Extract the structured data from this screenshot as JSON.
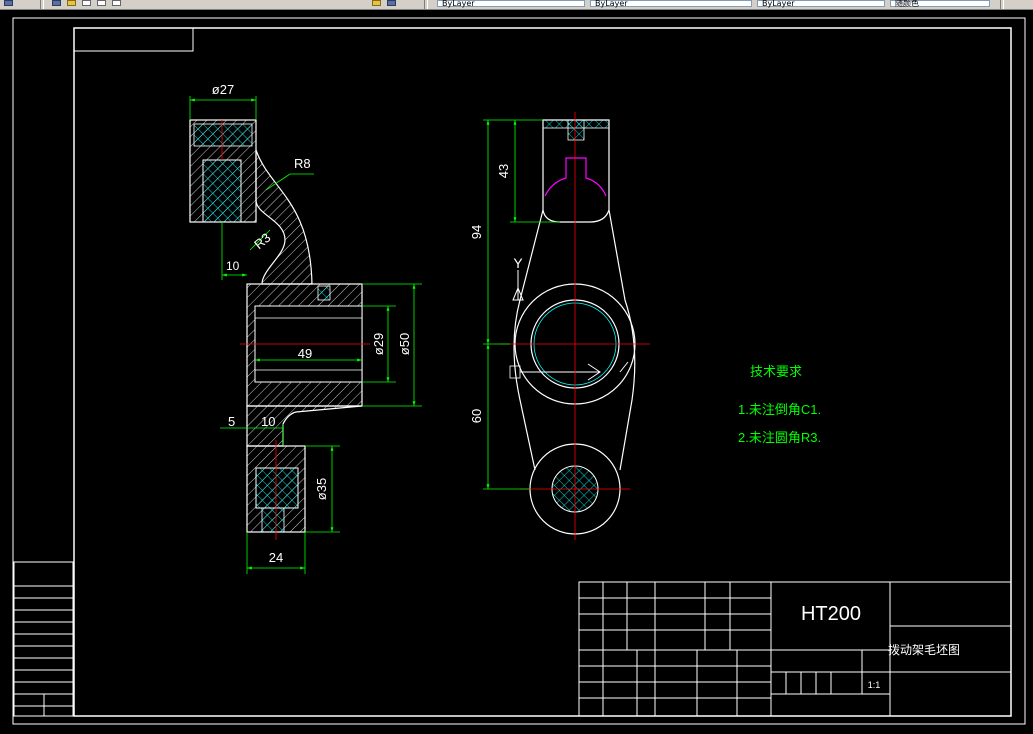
{
  "window": {
    "title": ""
  },
  "toolbar": {
    "layer_fields": [
      "ByLayer",
      "ByLayer",
      "ByLayer"
    ],
    "plot_style": "随颜色"
  },
  "drawing": {
    "technical_requirements": {
      "heading": "技术要求",
      "items": [
        "1.未注倒角C1.",
        "2.未注圆角R3."
      ]
    },
    "title_block": {
      "material": "HT200",
      "part_name": "拨动架毛坯图",
      "scale": "1:1"
    },
    "dimensions": {
      "side": {
        "d27": "ø27",
        "r8": "R8",
        "r3": "R3",
        "d10a": "10",
        "d49": "49",
        "d29": "ø29",
        "d50": "ø50",
        "d5": "5",
        "d10b": "10",
        "d35": "ø35",
        "d24": "24"
      },
      "front": {
        "d43": "43",
        "d94": "94",
        "d60": "60",
        "axis_y": "Y"
      }
    },
    "colors": {
      "background": "#000000",
      "outline": "#ffffff",
      "dimension": "#00ff00",
      "centerline": "#ff0000",
      "text": "#ffffff",
      "hidden": "#ff00ff",
      "hatch": "#00ffff"
    }
  }
}
